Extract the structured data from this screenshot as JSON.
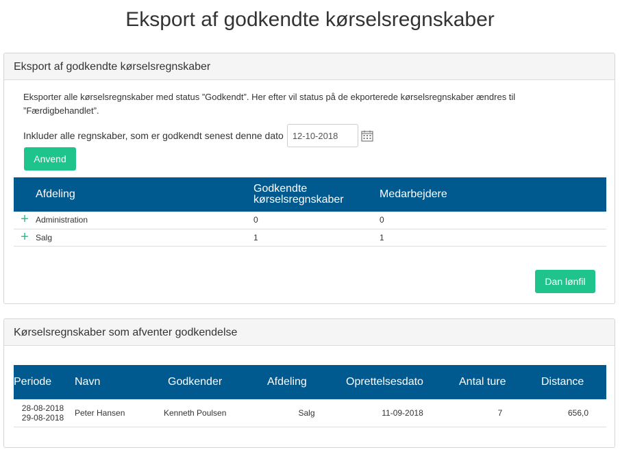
{
  "page": {
    "title": "Eksport af godkendte kørselsregnskaber"
  },
  "export_panel": {
    "heading": "Eksport af godkendte kørselsregnskaber",
    "description": "Eksporter alle kørselsregnskaber med status ”Godkendt”. Her efter vil status på de ekporterede kørselsregnskaber ændres til ”Færdigbehandlet”.",
    "date_label": "Inkluder alle regnskaber, som er godkendt senest denne dato",
    "date_value": "12-10-2018",
    "apply_label": "Anvend",
    "payfile_label": "Dan lønfil",
    "table": {
      "headers": [
        "Afdeling",
        "Godkendte kørselsregnskaber",
        "Medarbejdere"
      ],
      "rows": [
        {
          "department": "Administration",
          "approved": "0",
          "employees": "0"
        },
        {
          "department": "Salg",
          "approved": "1",
          "employees": "1"
        }
      ]
    }
  },
  "pending_panel": {
    "heading": "Kørselsregnskaber som afventer godkendelse",
    "table": {
      "headers": [
        "Periode",
        "Navn",
        "Godkender",
        "Afdeling",
        "Oprettelsesdato",
        "Antal ture",
        "Distance"
      ],
      "rows": [
        {
          "period_from": "28-08-2018",
          "period_to": "29-08-2018",
          "name": "Peter Hansen",
          "approver": "Kenneth Poulsen",
          "department": "Salg",
          "created": "11-09-2018",
          "trips": "7",
          "distance": "656,0"
        }
      ]
    }
  },
  "colors": {
    "accent_green": "#1ec48c",
    "header_blue": "#005a8f",
    "panel_head_bg": "#f5f5f5"
  },
  "icons": {
    "expand": "plus-icon",
    "date_picker": "calendar-icon"
  }
}
